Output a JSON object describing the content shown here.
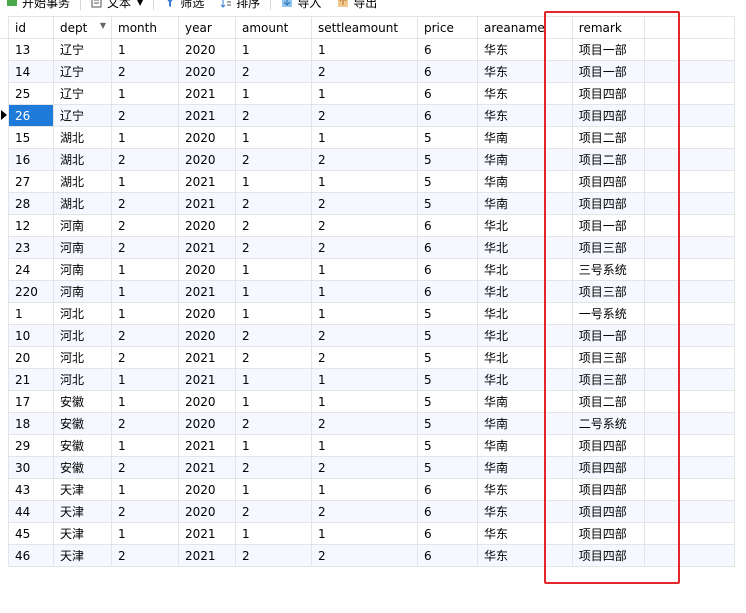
{
  "toolbar": {
    "items": [
      {
        "label": "开始事务",
        "icon": "transaction-icon"
      },
      {
        "label": "文本",
        "icon": "text-icon"
      },
      {
        "label": "筛选",
        "icon": "filter-icon"
      },
      {
        "label": "排序",
        "icon": "sort-icon"
      },
      {
        "label": "导入",
        "icon": "import-icon"
      },
      {
        "label": "导出",
        "icon": "export-icon"
      }
    ]
  },
  "grid": {
    "columns": [
      "id",
      "dept",
      "month",
      "year",
      "amount",
      "settleamount",
      "price",
      "areaname",
      "",
      "remark",
      ""
    ],
    "selected_row": 3,
    "rows": [
      [
        "13",
        "辽宁",
        "1",
        "2020",
        "1",
        "1",
        "6",
        "华东",
        "",
        "项目一部",
        ""
      ],
      [
        "14",
        "辽宁",
        "2",
        "2020",
        "2",
        "2",
        "6",
        "华东",
        "",
        "项目一部",
        ""
      ],
      [
        "25",
        "辽宁",
        "1",
        "2021",
        "1",
        "1",
        "6",
        "华东",
        "",
        "项目四部",
        ""
      ],
      [
        "26",
        "辽宁",
        "2",
        "2021",
        "2",
        "2",
        "6",
        "华东",
        "",
        "项目四部",
        ""
      ],
      [
        "15",
        "湖北",
        "1",
        "2020",
        "1",
        "1",
        "5",
        "华南",
        "",
        "项目二部",
        ""
      ],
      [
        "16",
        "湖北",
        "2",
        "2020",
        "2",
        "2",
        "5",
        "华南",
        "",
        "项目二部",
        ""
      ],
      [
        "27",
        "湖北",
        "1",
        "2021",
        "1",
        "1",
        "5",
        "华南",
        "",
        "项目四部",
        ""
      ],
      [
        "28",
        "湖北",
        "2",
        "2021",
        "2",
        "2",
        "5",
        "华南",
        "",
        "项目四部",
        ""
      ],
      [
        "12",
        "河南",
        "2",
        "2020",
        "2",
        "2",
        "6",
        "华北",
        "",
        "项目一部",
        ""
      ],
      [
        "23",
        "河南",
        "2",
        "2021",
        "2",
        "2",
        "6",
        "华北",
        "",
        "项目三部",
        ""
      ],
      [
        "24",
        "河南",
        "1",
        "2020",
        "1",
        "1",
        "6",
        "华北",
        "",
        "三号系统",
        ""
      ],
      [
        "220",
        "河南",
        "1",
        "2021",
        "1",
        "1",
        "6",
        "华北",
        "",
        "项目三部",
        ""
      ],
      [
        "1",
        "河北",
        "1",
        "2020",
        "1",
        "1",
        "5",
        "华北",
        "",
        "一号系统",
        ""
      ],
      [
        "10",
        "河北",
        "2",
        "2020",
        "2",
        "2",
        "5",
        "华北",
        "",
        "项目一部",
        ""
      ],
      [
        "20",
        "河北",
        "2",
        "2021",
        "2",
        "2",
        "5",
        "华北",
        "",
        "项目三部",
        ""
      ],
      [
        "21",
        "河北",
        "1",
        "2021",
        "1",
        "1",
        "5",
        "华北",
        "",
        "项目三部",
        ""
      ],
      [
        "17",
        "安徽",
        "1",
        "2020",
        "1",
        "1",
        "5",
        "华南",
        "",
        "项目二部",
        ""
      ],
      [
        "18",
        "安徽",
        "2",
        "2020",
        "2",
        "2",
        "5",
        "华南",
        "",
        "二号系统",
        ""
      ],
      [
        "29",
        "安徽",
        "1",
        "2021",
        "1",
        "1",
        "5",
        "华南",
        "",
        "项目四部",
        ""
      ],
      [
        "30",
        "安徽",
        "2",
        "2021",
        "2",
        "2",
        "5",
        "华南",
        "",
        "项目四部",
        ""
      ],
      [
        "43",
        "天津",
        "1",
        "2020",
        "1",
        "1",
        "6",
        "华东",
        "",
        "项目四部",
        ""
      ],
      [
        "44",
        "天津",
        "2",
        "2020",
        "2",
        "2",
        "6",
        "华东",
        "",
        "项目四部",
        ""
      ],
      [
        "45",
        "天津",
        "1",
        "2021",
        "1",
        "1",
        "6",
        "华东",
        "",
        "项目四部",
        ""
      ],
      [
        "46",
        "天津",
        "2",
        "2021",
        "2",
        "2",
        "6",
        "华东",
        "",
        "项目四部",
        ""
      ]
    ]
  },
  "colors": {
    "selection": "#1e7bd9",
    "highlight_border": "#e4262a",
    "alt_row": "#f5f9ff"
  }
}
